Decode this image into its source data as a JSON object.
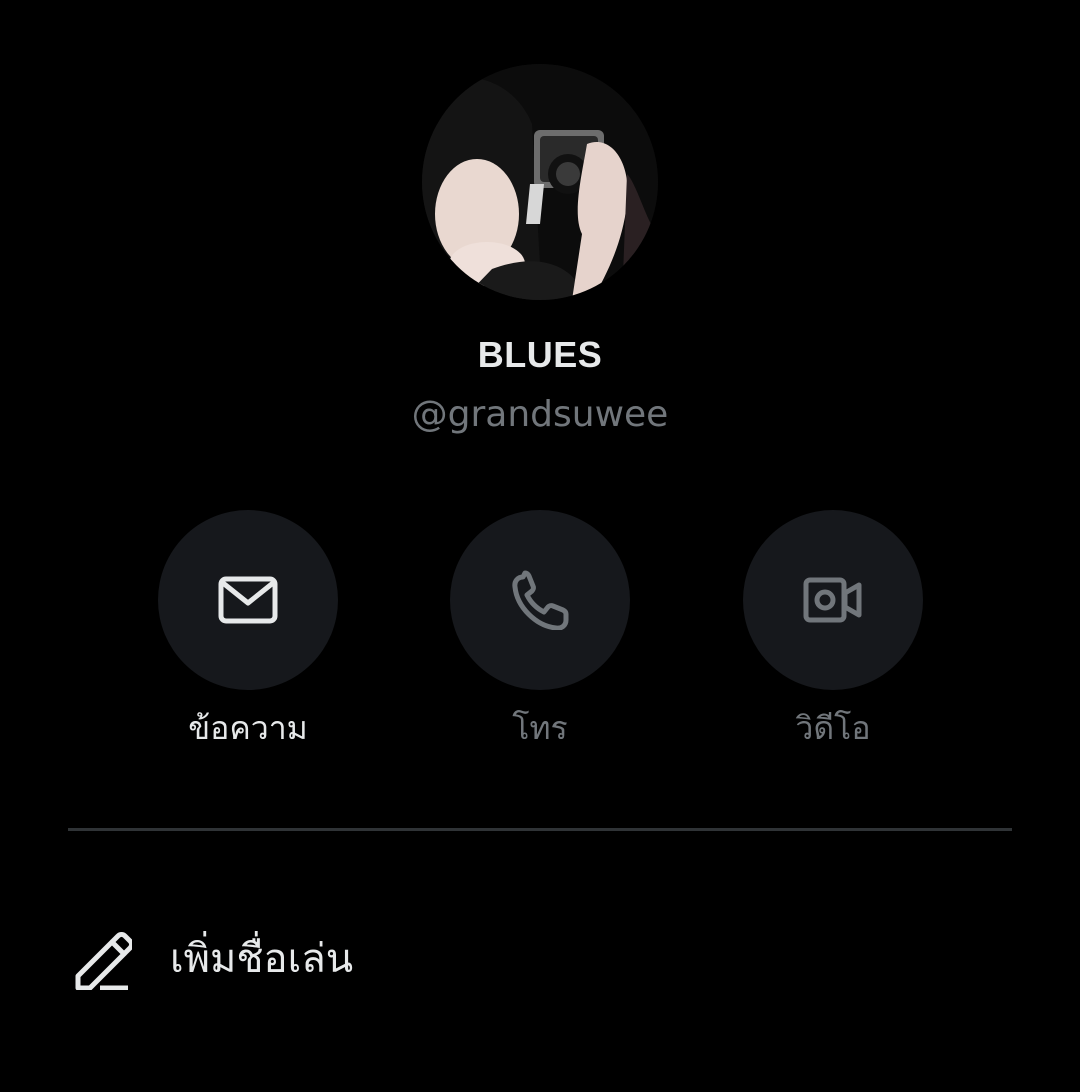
{
  "profile": {
    "display_name": "BLUES",
    "handle": "@grandsuwee",
    "avatar_icon": "profile-photo"
  },
  "actions": [
    {
      "label": "ข้อความ",
      "icon": "envelope-icon",
      "enabled": true
    },
    {
      "label": "โทร",
      "icon": "phone-icon",
      "enabled": false
    },
    {
      "label": "วิดีโอ",
      "icon": "video-camera-icon",
      "enabled": false
    }
  ],
  "nickname": {
    "label": "เพิ่มชื่อเล่น",
    "icon": "pencil-icon"
  },
  "colors": {
    "background": "#000000",
    "primary_text": "#e7e9ea",
    "secondary_text": "#71767b",
    "button_bg": "#16181c",
    "divider": "#2f3336"
  }
}
